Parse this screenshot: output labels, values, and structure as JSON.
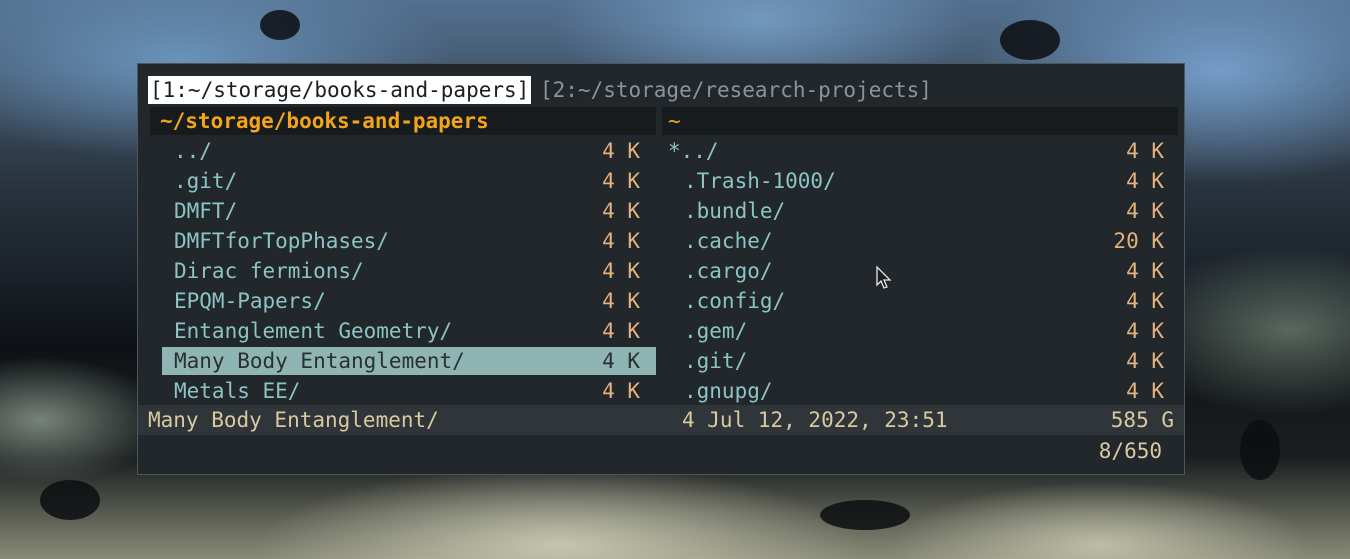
{
  "tabs": {
    "active": "[1:~/storage/books-and-papers]",
    "inactive": "[2:~/storage/research-projects]"
  },
  "left_pane": {
    "path": "~/storage/books-and-papers",
    "rows": [
      {
        "name": "../",
        "size": "4 K"
      },
      {
        "name": ".git/",
        "size": "4 K"
      },
      {
        "name": "DMFT/",
        "size": "4 K"
      },
      {
        "name": "DMFTforTopPhases/",
        "size": "4 K"
      },
      {
        "name": "Dirac fermions/",
        "size": "4 K"
      },
      {
        "name": "EPQM-Papers/",
        "size": "4 K"
      },
      {
        "name": "Entanglement Geometry/",
        "size": "4 K"
      },
      {
        "name": "Many Body Entanglement/",
        "size": "4 K"
      },
      {
        "name": "Metals EE/",
        "size": "4 K"
      }
    ],
    "selected_index": 7
  },
  "right_pane": {
    "path": "~",
    "rows": [
      {
        "name": "*../",
        "size": "4 K"
      },
      {
        "name": ".Trash-1000/",
        "size": "4 K"
      },
      {
        "name": ".bundle/",
        "size": "4 K"
      },
      {
        "name": ".cache/",
        "size": "20 K"
      },
      {
        "name": ".cargo/",
        "size": "4 K"
      },
      {
        "name": ".config/",
        "size": "4 K"
      },
      {
        "name": ".gem/",
        "size": "4 K"
      },
      {
        "name": ".git/",
        "size": "4 K"
      },
      {
        "name": ".gnupg/",
        "size": "4 K"
      }
    ]
  },
  "status": {
    "name": "Many Body Entanglement/",
    "info": "4 Jul 12, 2022, 23:51",
    "free": "585 G",
    "position": "8/650"
  },
  "colors": {
    "terminal_bg": "#22272b",
    "header_path": "#f2a51a",
    "dir_name": "#8cc4c4",
    "size": "#e4b27e",
    "selection_bg": "#8fb5b3",
    "status_text": "#d9c9a0"
  },
  "icons": {
    "cursor": "mouse-pointer-icon"
  }
}
